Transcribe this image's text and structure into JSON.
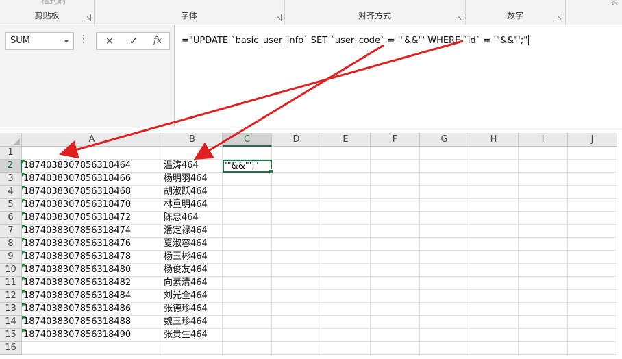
{
  "ribbon": {
    "top_partial_label": "格式刷",
    "groups": [
      {
        "label": "剪贴板"
      },
      {
        "label": "字体"
      },
      {
        "label": "对齐方式"
      },
      {
        "label": "数字"
      }
    ],
    "right_partial_label": "表"
  },
  "formula_bar": {
    "name_box": "SUM",
    "cancel_icon": "✕",
    "enter_icon": "✓",
    "fx_label": "fx",
    "formula": "=\"UPDATE `basic_user_info` SET `user_code` = '\"&&\"' WHERE `id` = '\"&&\"';\""
  },
  "sheet": {
    "columns": [
      "A",
      "B",
      "C",
      "D",
      "E",
      "F",
      "G",
      "H",
      "I",
      "J"
    ],
    "active_column": "C",
    "active_row": 2,
    "rows": [
      {
        "n": "1",
        "a": "",
        "b": "",
        "c": ""
      },
      {
        "n": "2",
        "a": "1874038307856318464",
        "b": "温涛464",
        "c": "'\"&&\"';\""
      },
      {
        "n": "3",
        "a": "1874038307856318466",
        "b": "杨明羽464",
        "c": ""
      },
      {
        "n": "4",
        "a": "1874038307856318468",
        "b": "胡淑跃464",
        "c": ""
      },
      {
        "n": "5",
        "a": "1874038307856318470",
        "b": "林重明464",
        "c": ""
      },
      {
        "n": "6",
        "a": "1874038307856318472",
        "b": "陈忠464",
        "c": ""
      },
      {
        "n": "7",
        "a": "1874038307856318474",
        "b": "潘定禄464",
        "c": ""
      },
      {
        "n": "8",
        "a": "1874038307856318476",
        "b": "夏淑容464",
        "c": ""
      },
      {
        "n": "9",
        "a": "1874038307856318478",
        "b": "杨玉彬464",
        "c": ""
      },
      {
        "n": "10",
        "a": "1874038307856318480",
        "b": "杨俊友464",
        "c": ""
      },
      {
        "n": "11",
        "a": "1874038307856318482",
        "b": "向素清464",
        "c": ""
      },
      {
        "n": "12",
        "a": "1874038307856318484",
        "b": "刘光全464",
        "c": ""
      },
      {
        "n": "13",
        "a": "1874038307856318486",
        "b": "张德珍464",
        "c": ""
      },
      {
        "n": "14",
        "a": "1874038307856318488",
        "b": "魏玉珍464",
        "c": ""
      },
      {
        "n": "15",
        "a": "1874038307856318490",
        "b": "张贵生464",
        "c": ""
      },
      {
        "n": "16",
        "a": "",
        "b": "",
        "c": ""
      }
    ]
  },
  "annotation_color": "#e02020"
}
